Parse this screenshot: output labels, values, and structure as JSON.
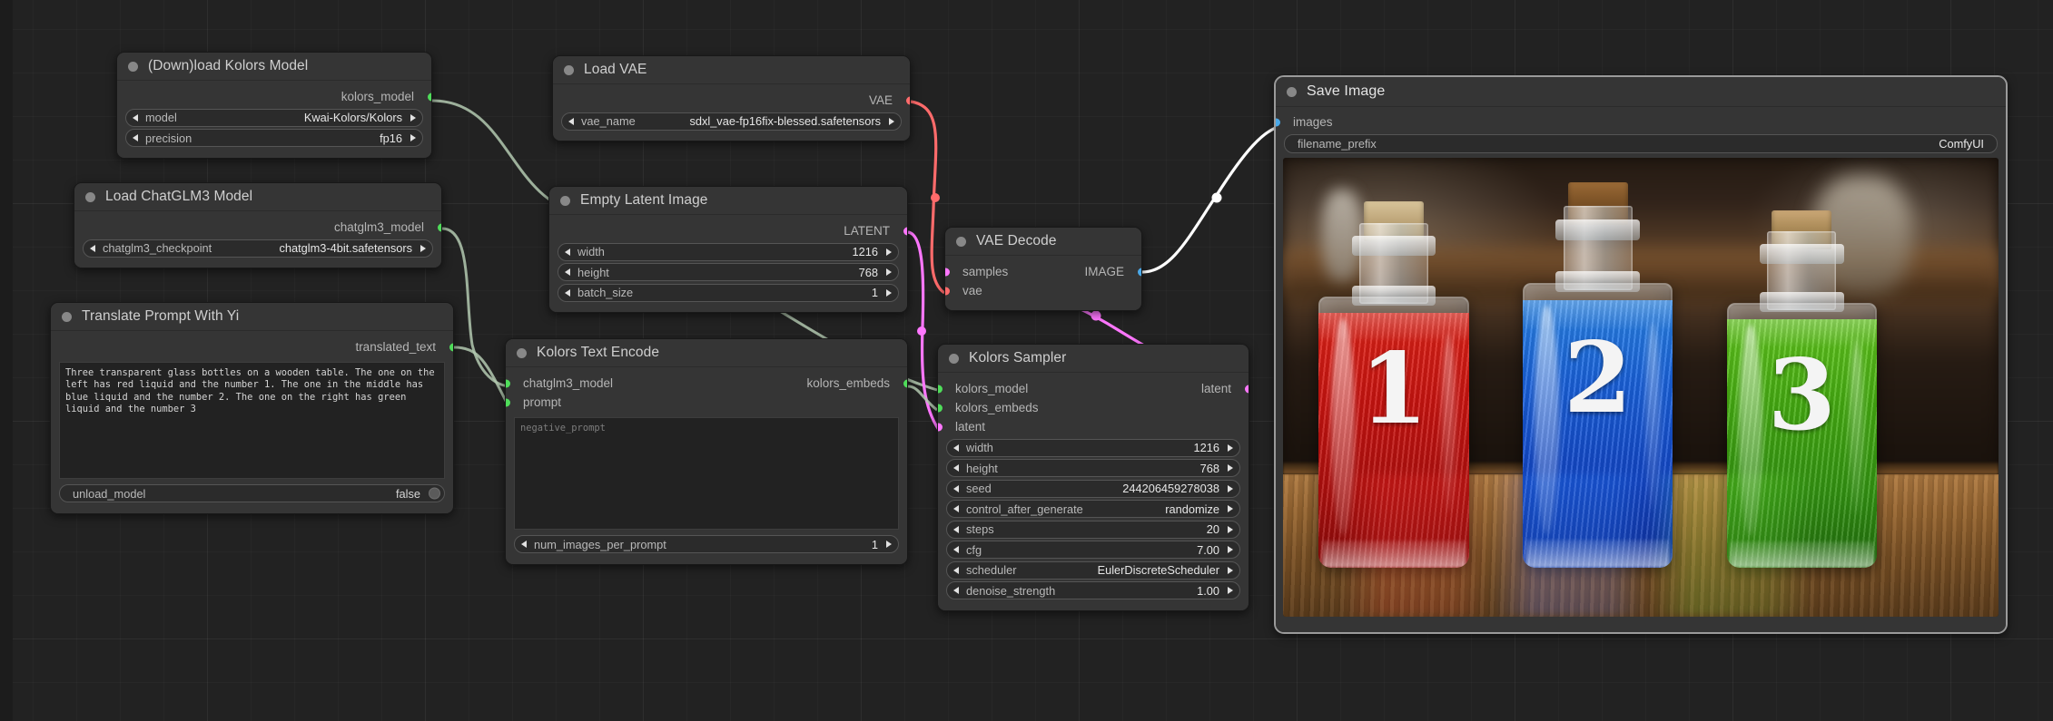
{
  "app": "ComfyUI",
  "canvas": {
    "background_color": "#222222",
    "grid": true
  },
  "link_colors": {
    "model": "#b3c9b0",
    "vae": "#ff6b6b",
    "latent": "#ff77ff",
    "image": "#ffffff",
    "conditioning": "#c8d8c4"
  },
  "port_colors": {
    "model": "#4fdd5a",
    "vae": "#ff6b6b",
    "latent": "#ff77ff",
    "image": "#4aa8e8",
    "string": "#4fdd5a",
    "conditioning": "#4fdd5a"
  },
  "nodes": [
    {
      "id": "download-kolors-model",
      "title": "(Down)load Kolors Model",
      "outputs": [
        {
          "label": "kolors_model",
          "color": "#4fdd5a"
        }
      ],
      "widgets": [
        {
          "label": "model",
          "value": "Kwai-Kolors/Kolors",
          "type": "combo"
        },
        {
          "label": "precision",
          "value": "fp16",
          "type": "combo"
        }
      ]
    },
    {
      "id": "load-chatglm3-model",
      "title": "Load ChatGLM3 Model",
      "outputs": [
        {
          "label": "chatglm3_model",
          "color": "#4fdd5a"
        }
      ],
      "widgets": [
        {
          "label": "chatglm3_checkpoint",
          "value": "chatglm3-4bit.safetensors",
          "type": "combo"
        }
      ]
    },
    {
      "id": "translate-prompt-with-yi",
      "title": "Translate Prompt With Yi",
      "outputs": [
        {
          "label": "translated_text",
          "color": "#4fdd5a"
        }
      ],
      "textarea": "Three transparent glass bottles on a wooden table. The one on the left has red liquid and the number 1. The one in the middle has blue liquid and the number 2. The one on the right has green liquid and the number 3",
      "widgets": [
        {
          "label": "unload_model",
          "value": "false",
          "type": "toggle"
        }
      ]
    },
    {
      "id": "load-vae",
      "title": "Load VAE",
      "outputs": [
        {
          "label": "VAE",
          "color": "#ff6b6b"
        }
      ],
      "widgets": [
        {
          "label": "vae_name",
          "value": "sdxl_vae-fp16fix-blessed.safetensors",
          "type": "combo"
        }
      ]
    },
    {
      "id": "empty-latent-image",
      "title": "Empty Latent Image",
      "outputs": [
        {
          "label": "LATENT",
          "color": "#ff77ff"
        }
      ],
      "widgets": [
        {
          "label": "width",
          "value": "1216",
          "type": "number"
        },
        {
          "label": "height",
          "value": "768",
          "type": "number"
        },
        {
          "label": "batch_size",
          "value": "1",
          "type": "number"
        }
      ]
    },
    {
      "id": "kolors-text-encode",
      "title": "Kolors Text Encode",
      "inputs": [
        {
          "label": "chatglm3_model",
          "color": "#4fdd5a"
        },
        {
          "label": "prompt",
          "color": "#4fdd5a"
        }
      ],
      "outputs": [
        {
          "label": "kolors_embeds",
          "color": "#4fdd5a"
        }
      ],
      "textarea_placeholder": "negative_prompt",
      "widgets": [
        {
          "label": "num_images_per_prompt",
          "value": "1",
          "type": "number"
        }
      ]
    },
    {
      "id": "vae-decode",
      "title": "VAE Decode",
      "inputs": [
        {
          "label": "samples",
          "color": "#ff77ff"
        },
        {
          "label": "vae",
          "color": "#ff6b6b"
        }
      ],
      "outputs": [
        {
          "label": "IMAGE",
          "color": "#4aa8e8"
        }
      ]
    },
    {
      "id": "kolors-sampler",
      "title": "Kolors Sampler",
      "inputs": [
        {
          "label": "kolors_model",
          "color": "#4fdd5a"
        },
        {
          "label": "kolors_embeds",
          "color": "#4fdd5a"
        },
        {
          "label": "latent",
          "color": "#ff77ff"
        }
      ],
      "outputs": [
        {
          "label": "latent",
          "color": "#ff77ff"
        }
      ],
      "widgets": [
        {
          "label": "width",
          "value": "1216",
          "type": "number"
        },
        {
          "label": "height",
          "value": "768",
          "type": "number"
        },
        {
          "label": "seed",
          "value": "244206459278038",
          "type": "number"
        },
        {
          "label": "control_after_generate",
          "value": "randomize",
          "type": "combo"
        },
        {
          "label": "steps",
          "value": "20",
          "type": "number"
        },
        {
          "label": "cfg",
          "value": "7.00",
          "type": "number"
        },
        {
          "label": "scheduler",
          "value": "EulerDiscreteScheduler",
          "type": "combo"
        },
        {
          "label": "denoise_strength",
          "value": "1.00",
          "type": "number"
        }
      ]
    },
    {
      "id": "save-image",
      "title": "Save Image",
      "inputs": [
        {
          "label": "images",
          "color": "#4aa8e8"
        }
      ],
      "widgets": [
        {
          "label": "filename_prefix",
          "value": "ComfyUI",
          "type": "text"
        }
      ],
      "preview": {
        "description": "Three transparent glass bottles on a wooden table with red, blue and green liquid",
        "bottles": [
          {
            "number": "1",
            "liquid": "red",
            "color": "#cc1111"
          },
          {
            "number": "2",
            "liquid": "blue",
            "color": "#1558d8"
          },
          {
            "number": "3",
            "liquid": "green",
            "color": "#3fae14"
          }
        ]
      }
    }
  ]
}
